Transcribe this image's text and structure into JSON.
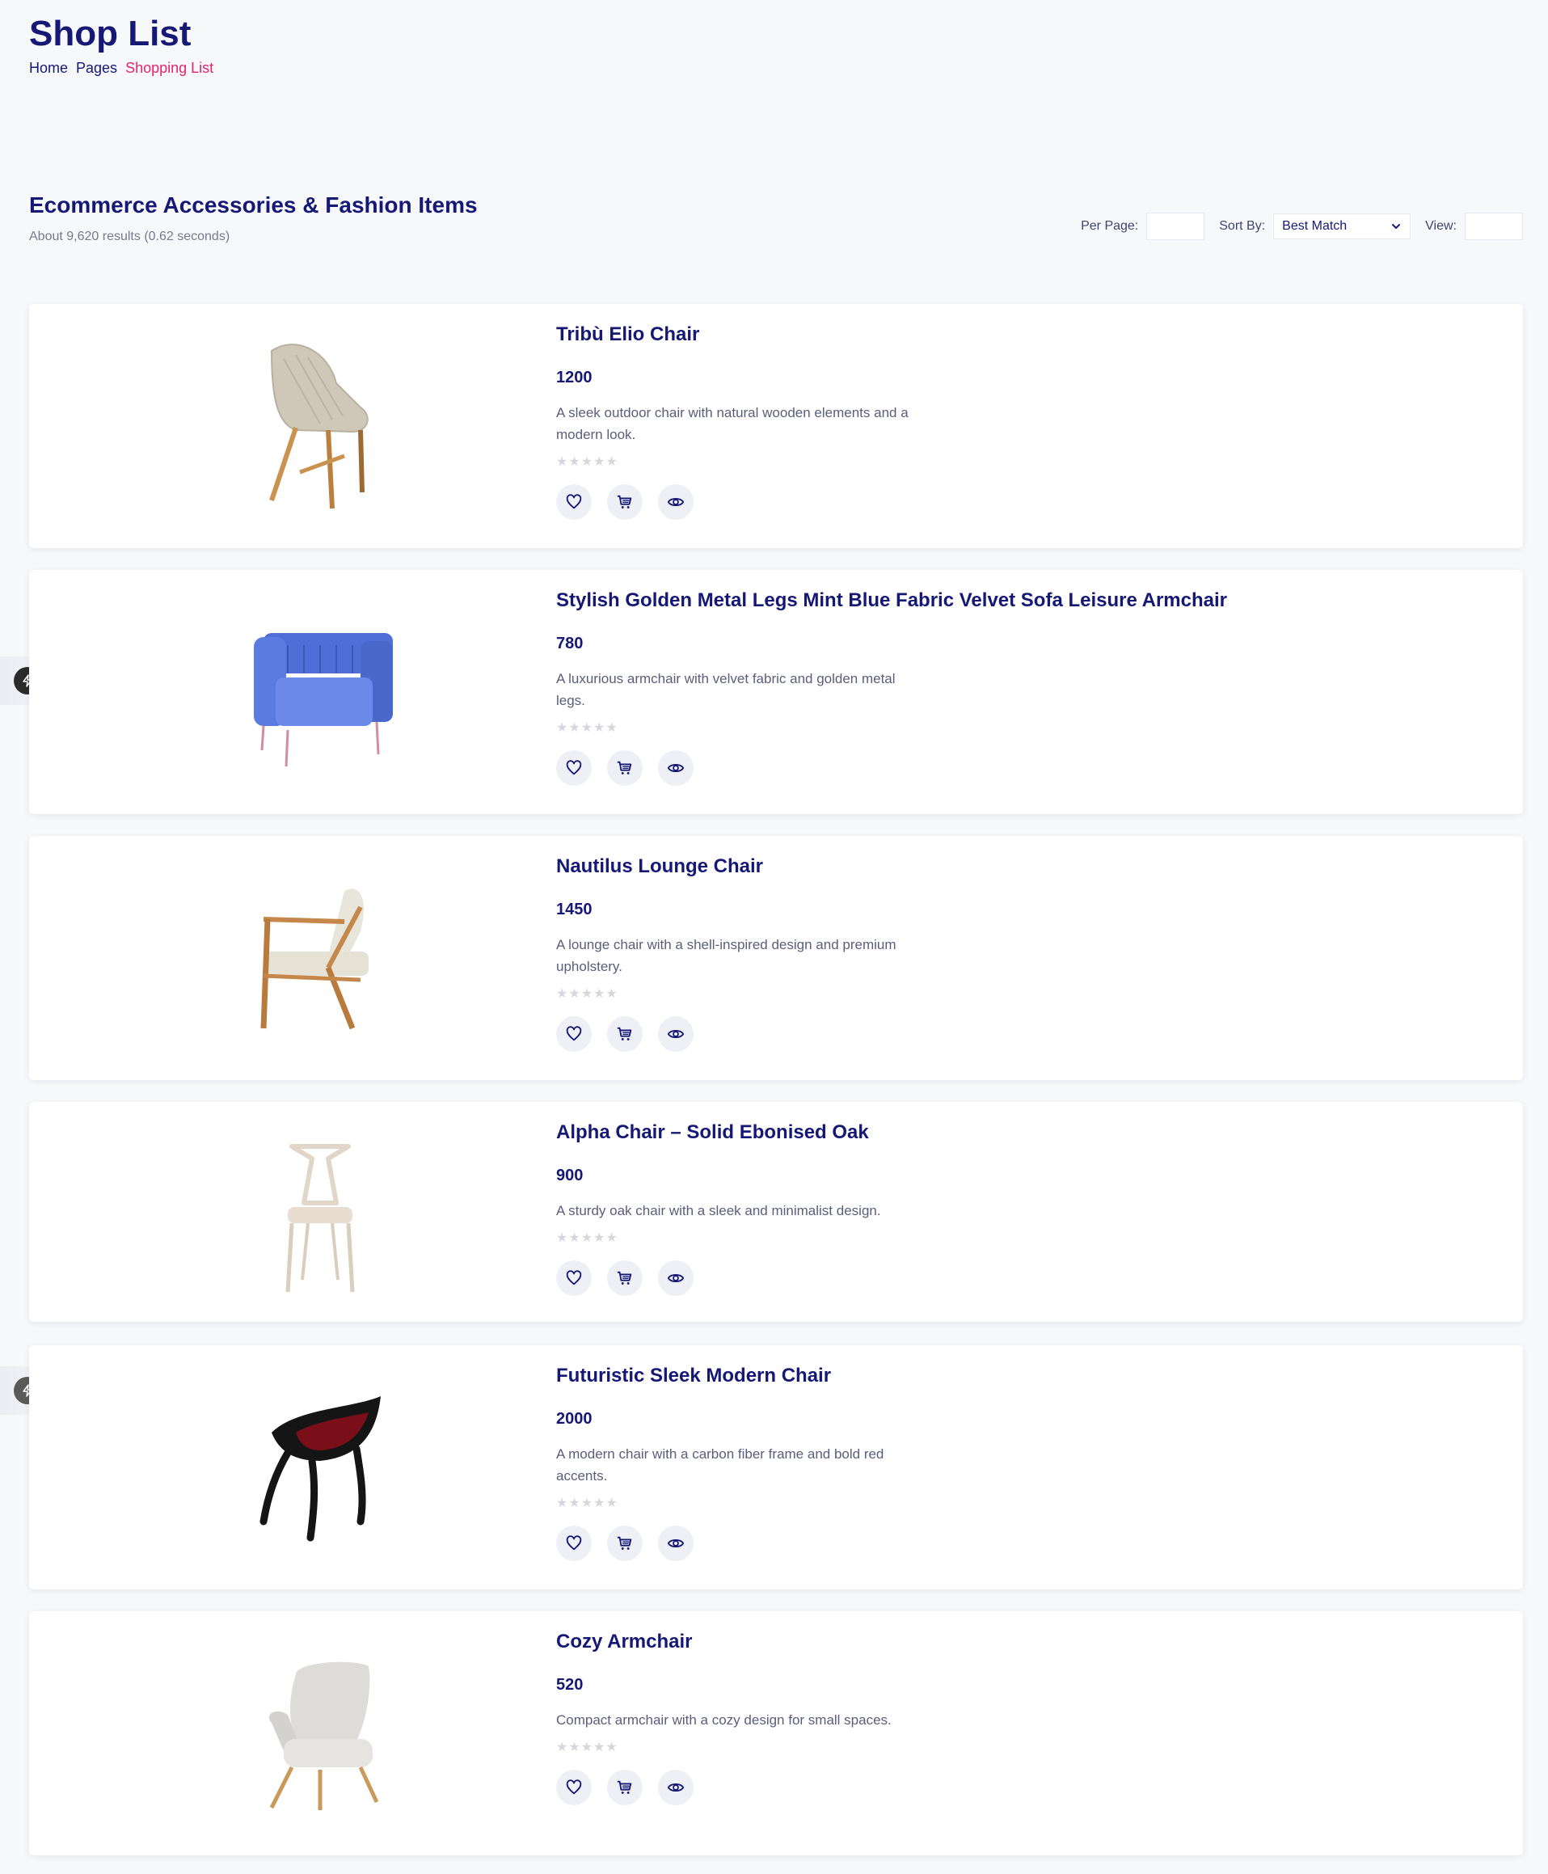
{
  "header": {
    "title": "Shop List",
    "breadcrumb": [
      "Home",
      "Pages",
      "Shopping List"
    ]
  },
  "section": {
    "title": "Ecommerce Accessories & Fashion Items",
    "results": "About 9,620 results (0.62 seconds)"
  },
  "controls": {
    "per_page_label": "Per Page:",
    "sort_label": "Sort By:",
    "sort_value": "Best Match",
    "view_label": "View:"
  },
  "products": [
    {
      "name": "Tribù Elio Chair",
      "price": "1200",
      "desc": "A sleek outdoor chair with natural wooden elements and a modern look.",
      "rating": "★★★★★"
    },
    {
      "name": "Stylish Golden Metal Legs Mint Blue Fabric Velvet Sofa Leisure Armchair",
      "price": "780",
      "desc": "A luxurious armchair with velvet fabric and golden metal legs.",
      "rating": "★★★★★"
    },
    {
      "name": "Nautilus Lounge Chair",
      "price": "1450",
      "desc": "A lounge chair with a shell-inspired design and premium upholstery.",
      "rating": "★★★★★"
    },
    {
      "name": "Alpha Chair – Solid Ebonised Oak",
      "price": "900",
      "desc": "A sturdy oak chair with a sleek and minimalist design.",
      "rating": "★★★★★"
    },
    {
      "name": "Futuristic Sleek Modern Chair",
      "price": "2000",
      "desc": "A modern chair with a carbon fiber frame and bold red accents.",
      "rating": "★★★★★"
    },
    {
      "name": "Cozy Armchair",
      "price": "520",
      "desc": "Compact armchair with a cozy design for small spaces.",
      "rating": "★★★★★"
    }
  ],
  "colors": {
    "brand_navy": "#151875",
    "accent_pink": "#e0246c",
    "background": "#f7f8fa"
  }
}
